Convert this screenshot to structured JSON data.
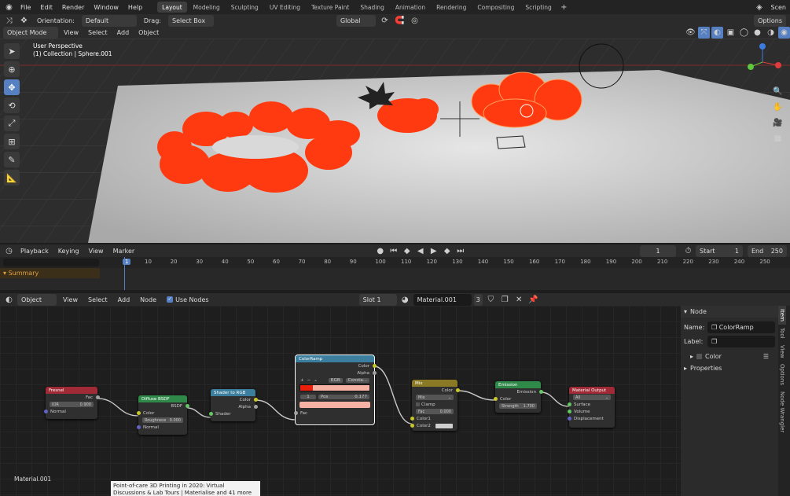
{
  "menu": {
    "items": [
      "File",
      "Edit",
      "Render",
      "Window",
      "Help"
    ]
  },
  "workspaces": [
    "Layout",
    "Modeling",
    "Sculpting",
    "UV Editing",
    "Texture Paint",
    "Shading",
    "Animation",
    "Rendering",
    "Compositing",
    "Scripting"
  ],
  "active_workspace": "Layout",
  "scene_label": "Scen",
  "tool_header": {
    "orientation_label": "Orientation:",
    "orientation_value": "Default",
    "drag_label": "Drag:",
    "drag_value": "Select Box",
    "transform_value": "Global",
    "options": "Options"
  },
  "viewport_header": {
    "mode": "Object Mode",
    "menus": [
      "View",
      "Select",
      "Add",
      "Object"
    ]
  },
  "viewport": {
    "perspective": "User Perspective",
    "collection": "(1) Collection | Sphere.001"
  },
  "timeline": {
    "menus": [
      "Playback",
      "Keying",
      "View",
      "Marker"
    ],
    "current_frame": "1",
    "start_label": "Start",
    "start": "1",
    "end_label": "End",
    "end": "250",
    "ticks": [
      "1",
      "10",
      "20",
      "30",
      "40",
      "50",
      "60",
      "70",
      "80",
      "90",
      "100",
      "110",
      "120",
      "130",
      "140",
      "150",
      "160",
      "170",
      "180",
      "190",
      "200",
      "210",
      "220",
      "230",
      "240",
      "250"
    ],
    "summary": "Summary"
  },
  "node_header": {
    "mode": "Object",
    "menus": [
      "View",
      "Select",
      "Add",
      "Node"
    ],
    "use_nodes": "Use Nodes",
    "slot": "Slot 1",
    "material": "Material.001",
    "users": "3"
  },
  "material_label": "Material.001",
  "nodes": {
    "fresnel": {
      "title": "Fresnel",
      "out": "Fac",
      "ior_label": "IOR",
      "ior": "0.900",
      "normal": "Normal"
    },
    "diffuse": {
      "title": "Diffuse BSDF",
      "out": "BSDF",
      "color": "Color",
      "rough_label": "Roughness",
      "rough": "0.000",
      "normal": "Normal"
    },
    "s2rgb": {
      "title": "Shader to RGB",
      "out_color": "Color",
      "out_alpha": "Alpha",
      "shader": "Shader"
    },
    "ramp": {
      "title": "ColorRamp",
      "out_color": "Color",
      "out_alpha": "Alpha",
      "mode": "RGB",
      "interp": "Consta...",
      "index": "1",
      "pos_label": "Pos",
      "pos": "0.177",
      "fac": "Fac"
    },
    "mix": {
      "title": "Mix",
      "out": "Color",
      "blend": "Mix",
      "clamp": "Clamp",
      "fac_label": "Fac",
      "fac": "0.000",
      "c1": "Color1",
      "c2": "Color2"
    },
    "emission": {
      "title": "Emission",
      "out": "Emission",
      "color": "Color",
      "strength_label": "Strength",
      "strength": "1.700"
    },
    "output": {
      "title": "Material Output",
      "target": "All",
      "surface": "Surface",
      "volume": "Volume",
      "displacement": "Displacement"
    }
  },
  "npanel": {
    "section": "Node",
    "name_label": "Name:",
    "name": "ColorRamp",
    "label_label": "Label:",
    "label": "",
    "color": "Color",
    "properties": "Properties",
    "tabs": [
      "Item",
      "Tool",
      "View",
      "Options",
      "Node Wrangler"
    ]
  },
  "tooltip": "Point-of-care 3D Printing in 2020: Virtual Discussions & Lab Tours | Materialise and 41 more pages - Microsoft",
  "colors": {
    "accent": "#5680c2",
    "cloud": "#ff3a10",
    "ramp_stop": "#e8200c",
    "ramp_end": "#f5b2a4"
  }
}
